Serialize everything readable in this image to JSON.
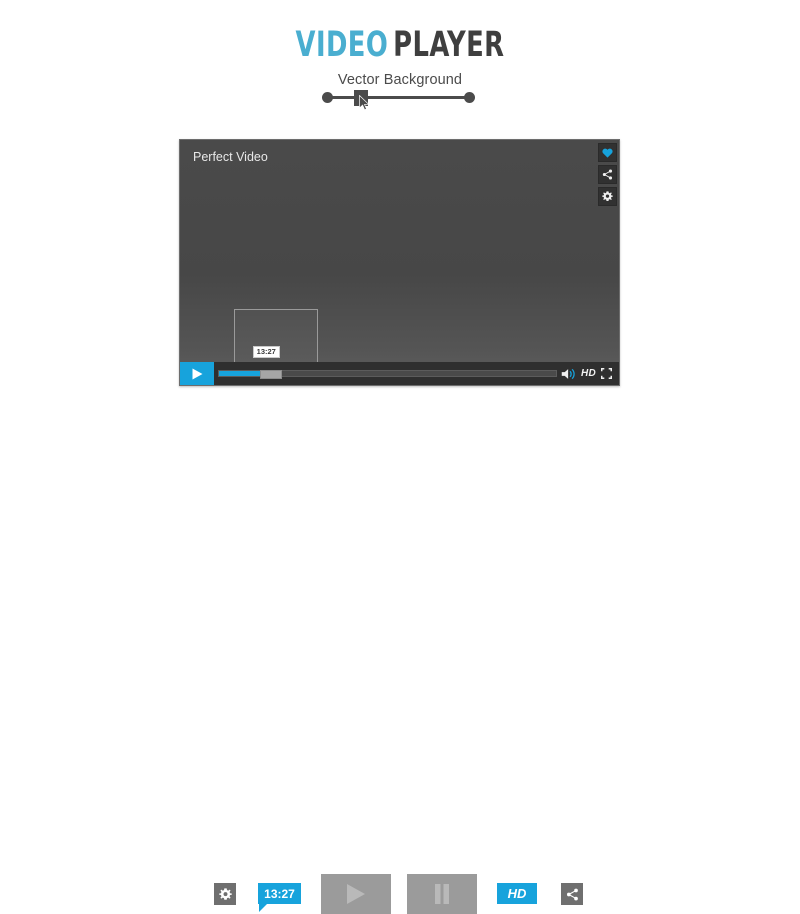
{
  "header": {
    "title_blue": "VIDEO",
    "title_dark": "PLAYER",
    "subtitle": "Vector Background",
    "slider": {
      "handle_icon": "slider-handle",
      "cursor_icon": "mouse-cursor-icon",
      "left_dot_icon": "slider-dot-left",
      "right_dot_icon": "slider-dot-right"
    }
  },
  "player": {
    "video_title": "Perfect Video",
    "icons": [
      {
        "name": "heart-icon",
        "label": "Favorite",
        "color": "#17a3dc"
      },
      {
        "name": "share-icon",
        "label": "Share",
        "color": "#f0f0f0"
      },
      {
        "name": "gear-icon",
        "label": "Settings",
        "color": "#f0f0f0"
      }
    ],
    "preview_thumbnail_label": "Seek preview",
    "controls": {
      "play_icon": "play-icon",
      "progress_percent": 12,
      "scrub_tooltip_time": "13:27",
      "volume_icon": "volume-icon",
      "hd_label": "HD",
      "fullscreen_icon": "fullscreen-icon"
    }
  },
  "bottom_strip": {
    "items": [
      {
        "name": "settings-button",
        "icon": "gear-icon",
        "label": ""
      },
      {
        "name": "time-tooltip",
        "icon": "tooltip",
        "label": "13:27"
      },
      {
        "name": "play-button",
        "icon": "play-icon",
        "label": ""
      },
      {
        "name": "pause-button",
        "icon": "pause-icon",
        "label": ""
      },
      {
        "name": "hd-badge",
        "icon": "hd",
        "label": "HD"
      },
      {
        "name": "share-button",
        "icon": "share-icon",
        "label": ""
      }
    ]
  },
  "colors": {
    "accent_blue": "#17a3dc",
    "title_blue": "#4aaed0",
    "dark_gray": "#3f3f3f",
    "player_bg": "#4a4a4a",
    "control_bar": "#2f2f2f",
    "strip_gray": "#9b9b9b"
  }
}
